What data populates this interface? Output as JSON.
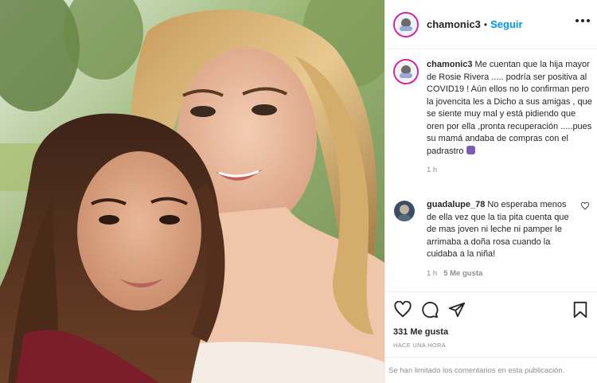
{
  "post": {
    "username": "chamonic3",
    "dot": "•",
    "follow_label": "Seguir",
    "caption": {
      "username": "chamonic3",
      "text": "Me cuentan que la hija mayor de Rosie Rivera ..... podría ser positiva al COVID19 ! Aún ellos no lo confirman pero la jovencita les a Dicho a sus amigas , que se siente muy mal y está pidiendo que oren por ella ,pronta recuperación .....pues su mamá andaba de compras con el padrastro",
      "time": "1 h"
    },
    "comments": [
      {
        "username": "guadalupe_78",
        "text": "No esperaba menos de ella vez que la tia pita cuenta que de mas joven ni leche ni pamper le arrimaba a doña rosa cuando la cuidaba a la niña!",
        "time": "1 h",
        "likes": "5 Me gusta"
      }
    ],
    "likes": "331 Me gusta",
    "posted": "HACE UNA HORA",
    "comments_limited": "Se han limitado los comentarios en esta publicación."
  },
  "icons": {
    "more": "more-options-icon",
    "like": "heart-icon",
    "comment": "comment-icon",
    "share": "share-icon",
    "save": "bookmark-icon",
    "comment_like": "heart-small-icon"
  },
  "colors": {
    "accent": "#0095f6",
    "text": "#262626",
    "muted": "#8e8e8e",
    "border": "#efefef"
  }
}
